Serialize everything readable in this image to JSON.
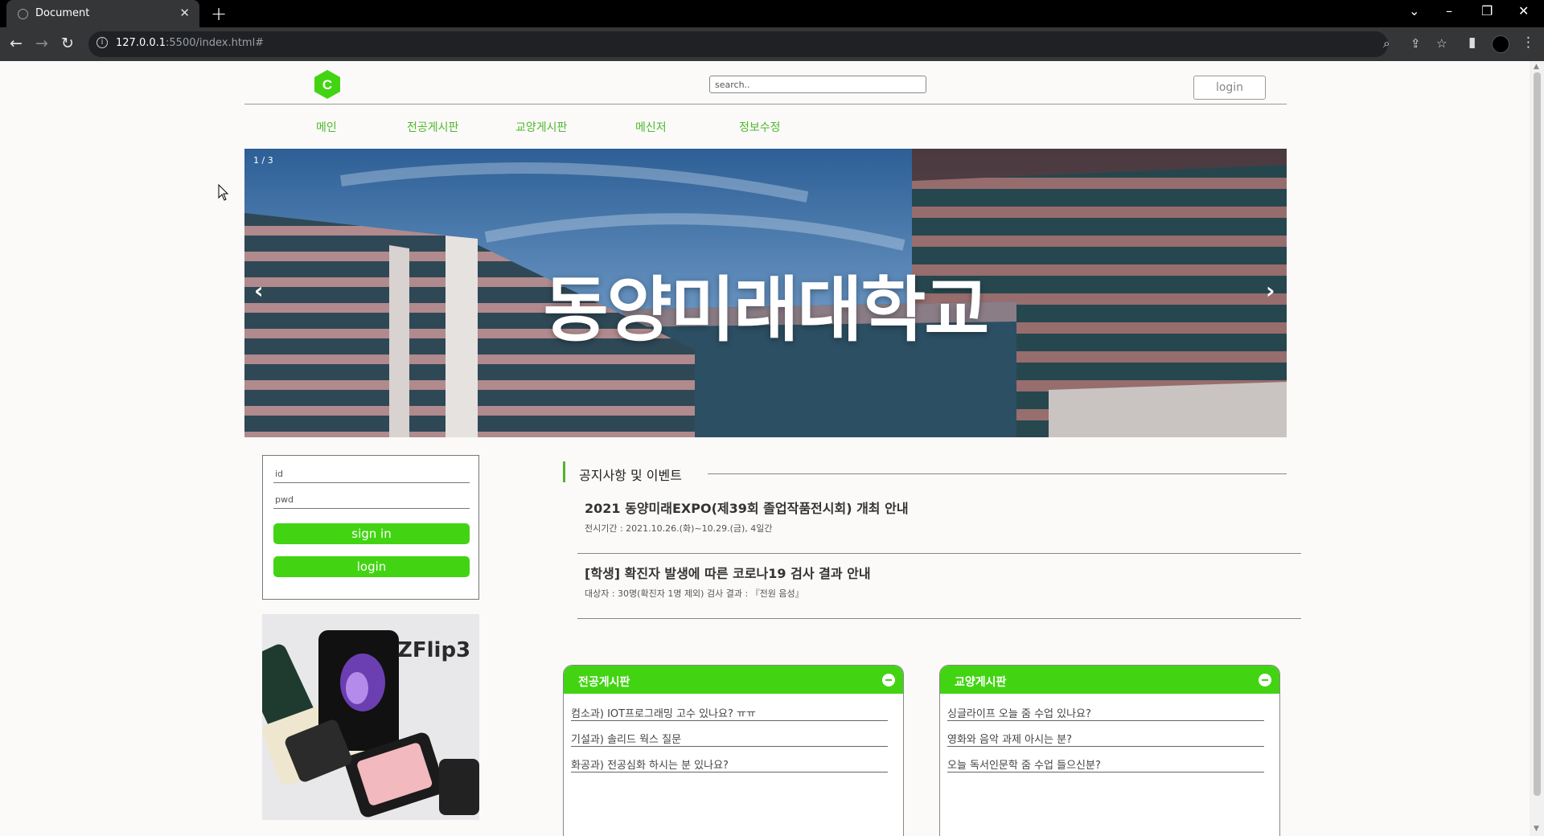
{
  "browser": {
    "tab_title": "Document",
    "url_host": "127.0.0.1",
    "url_rest": ":5500/index.html#"
  },
  "header": {
    "logo_letter": "C",
    "search_placeholder": "search..",
    "login_label": "login"
  },
  "menu": [
    "메인",
    "전공게시판",
    "교양게시판",
    "메신저",
    "정보수정"
  ],
  "slider": {
    "counter": "1 / 3",
    "title": "동양미래대학교",
    "prev": "‹",
    "next": "›"
  },
  "login_form": {
    "id_placeholder": "id",
    "pwd_placeholder": "pwd",
    "signin_label": "sign in",
    "login_label": "login"
  },
  "ad": {
    "text": "ZFlip3"
  },
  "notices": {
    "title": "공지사항 및 이벤트",
    "items": [
      {
        "headline": "2021 동양미래EXPO(제39회 졸업작품전시회) 개최 안내",
        "sub": "전시기간 : 2021.10.26.(화)~10.29.(금), 4일간"
      },
      {
        "headline": "[학생] 확진자 발생에 따른 코로나19 검사 결과 안내",
        "sub": "대상자 : 30명(확진자 1명 제외) 검사 결과 : 『전원 음성』"
      }
    ]
  },
  "boards": [
    {
      "title": "전공게시판",
      "rows": [
        "컴소과) IOT프로그래밍 고수 있나요? ㅠㅠ",
        "기설과) 솔리드 웍스 질문",
        "화공과) 전공심화 하시는 분 있나요?"
      ]
    },
    {
      "title": "교양게시판",
      "rows": [
        "싱글라이프 오늘 줌 수업 있나요?",
        "영화와 음악 과제 아시는 분?",
        "오늘 독서인문학 줌 수업 들으신분?"
      ]
    }
  ],
  "colors": {
    "accent_green": "#42d413",
    "menu_green": "#4fb82b"
  }
}
